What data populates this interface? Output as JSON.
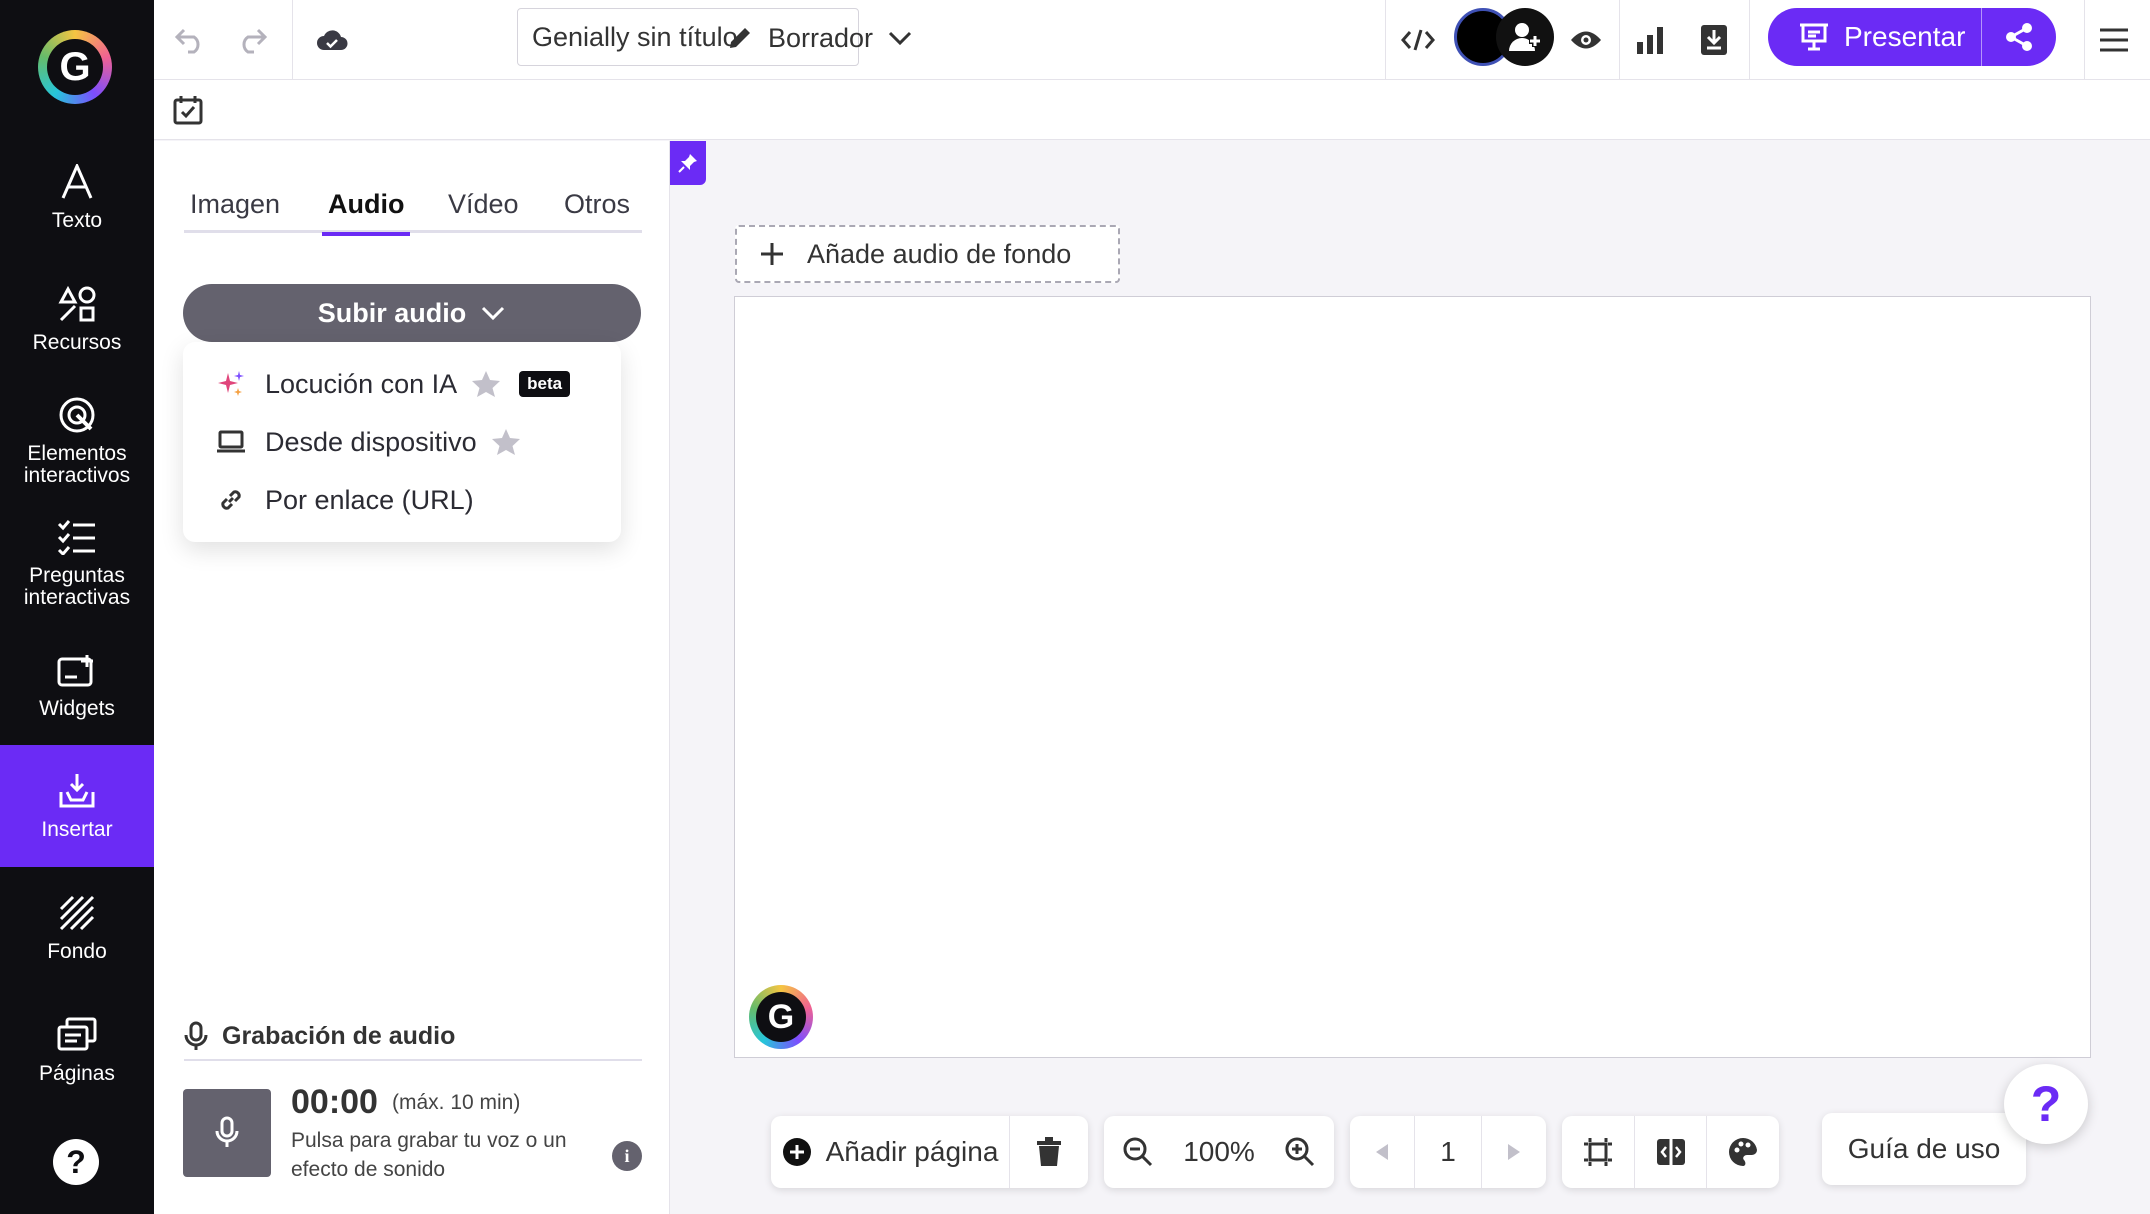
{
  "app": {
    "logo_letter": "G"
  },
  "rail": {
    "items": [
      {
        "label": "Texto",
        "icon": "text-icon"
      },
      {
        "label": "Recursos",
        "icon": "shapes-icon"
      },
      {
        "label": "Elementos interactivos",
        "icon": "interactive-icon"
      },
      {
        "label": "Preguntas interactivas",
        "icon": "checklist-icon"
      },
      {
        "label": "Widgets",
        "icon": "widget-icon"
      },
      {
        "label": "Insertar",
        "icon": "insert-icon",
        "active": true
      },
      {
        "label": "Fondo",
        "icon": "background-icon"
      },
      {
        "label": "Páginas",
        "icon": "pages-icon"
      }
    ],
    "help_label": "?"
  },
  "topbar": {
    "title_value": "Genially sin título",
    "status_label": "Borrador",
    "present_label": "Presentar"
  },
  "panel": {
    "tabs": [
      "Imagen",
      "Audio",
      "Vídeo",
      "Otros"
    ],
    "active_tab": "Audio",
    "upload_label": "Subir audio",
    "menu": [
      {
        "label": "Locución con IA",
        "icon": "sparkle-icon",
        "starred": true,
        "badge": "beta"
      },
      {
        "label": "Desde dispositivo",
        "icon": "laptop-icon",
        "starred": true
      },
      {
        "label": "Por enlace (URL)",
        "icon": "link-icon"
      }
    ],
    "recording": {
      "title": "Grabación de audio",
      "time": "00:00",
      "max": "(máx. 10 min)",
      "desc": "Pulsa para grabar tu voz o un efecto de sonido"
    }
  },
  "canvas": {
    "add_audio_label": "Añade audio de fondo"
  },
  "bottom": {
    "add_page_label": "Añadir página",
    "zoom": "100%",
    "page_number": "1",
    "guide_label": "Guía de uso",
    "help_label": "?"
  },
  "colors": {
    "accent": "#6b2bf5",
    "rail_bg": "#0e0e12",
    "button_gray": "#64626e"
  }
}
